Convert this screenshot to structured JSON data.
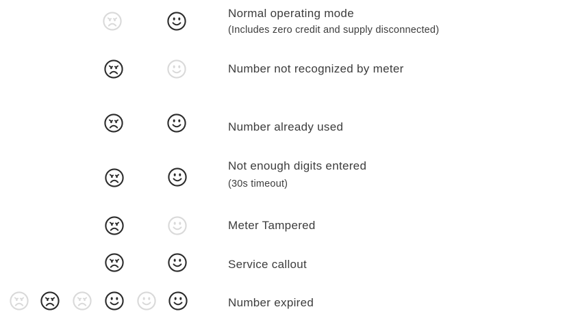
{
  "colors": {
    "active": "#2b2b2b",
    "inactive": "#d9d9d9",
    "text": "#3c3c3c"
  },
  "rows": [
    {
      "faces": [
        {
          "type": "sad",
          "state": "inactive"
        },
        {
          "type": "happy",
          "state": "active"
        }
      ],
      "line1": "Normal operating mode",
      "line2": "(Includes zero credit and supply disconnected)"
    },
    {
      "faces": [
        {
          "type": "sad",
          "state": "active"
        },
        {
          "type": "happy",
          "state": "inactive"
        }
      ],
      "line1": "Number not recognized by meter",
      "line2": ""
    },
    {
      "faces": [
        {
          "type": "sad",
          "state": "active"
        },
        {
          "type": "happy",
          "state": "active"
        }
      ],
      "line1": "Number already used",
      "line2": ""
    },
    {
      "faces": [
        {
          "type": "sad",
          "state": "active"
        },
        {
          "type": "happy",
          "state": "active"
        }
      ],
      "line1": "Not enough digits entered",
      "line2": "(30s timeout)"
    },
    {
      "faces": [
        {
          "type": "sad",
          "state": "active"
        },
        {
          "type": "happy",
          "state": "inactive"
        }
      ],
      "line1": "Meter Tampered",
      "line2": ""
    },
    {
      "faces": [
        {
          "type": "sad",
          "state": "active"
        },
        {
          "type": "happy",
          "state": "active"
        }
      ],
      "line1": "Service callout",
      "line2": ""
    },
    {
      "faces": [
        {
          "type": "sad",
          "state": "inactive"
        },
        {
          "type": "sad",
          "state": "active"
        },
        {
          "type": "sad",
          "state": "inactive"
        },
        {
          "type": "happy",
          "state": "active"
        },
        {
          "type": "happy",
          "state": "inactive"
        },
        {
          "type": "happy",
          "state": "active"
        }
      ],
      "line1": "Number expired",
      "line2": ""
    }
  ]
}
